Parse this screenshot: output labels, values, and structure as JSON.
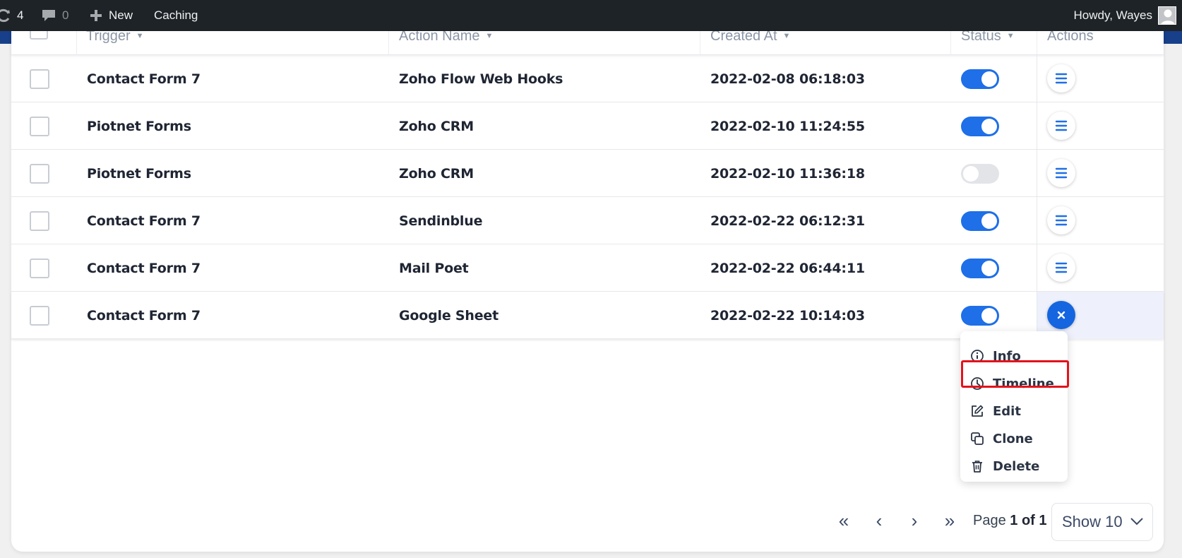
{
  "adminbar": {
    "updates_count": "4",
    "comments_count": "0",
    "new_label": "New",
    "caching_label": "Caching",
    "howdy": "Howdy, Wayes"
  },
  "table": {
    "columns": [
      "Trigger",
      "Action Name",
      "Created At",
      "Status",
      "Actions"
    ],
    "rows": [
      {
        "trigger": "Contact Form 7",
        "action": "Zoho Flow Web Hooks",
        "created": "2022-02-08 06:18:03",
        "status": "on"
      },
      {
        "trigger": "Piotnet Forms",
        "action": "Zoho CRM",
        "created": "2022-02-10 11:24:55",
        "status": "on"
      },
      {
        "trigger": "Piotnet Forms",
        "action": "Zoho CRM",
        "created": "2022-02-10 11:36:18",
        "status": "off"
      },
      {
        "trigger": "Contact Form 7",
        "action": "Sendinblue",
        "created": "2022-02-22 06:12:31",
        "status": "on"
      },
      {
        "trigger": "Contact Form 7",
        "action": "Mail Poet",
        "created": "2022-02-22 06:44:11",
        "status": "on"
      },
      {
        "trigger": "Contact Form 7",
        "action": "Google Sheet",
        "created": "2022-02-22 10:14:03",
        "status": "on"
      }
    ]
  },
  "dropdown": {
    "items": [
      "Info",
      "Timeline",
      "Edit",
      "Clone",
      "Delete"
    ],
    "highlighted": "Timeline"
  },
  "pagination": {
    "first": "«",
    "prev": "‹",
    "next": "›",
    "last": "»",
    "page_prefix": "Page",
    "page_value": "1 of 1",
    "show_label": "Show 10"
  },
  "colors": {
    "accent": "#1e6fe8",
    "adminbar": "#1d2327",
    "highlight_border": "#e3131c"
  }
}
